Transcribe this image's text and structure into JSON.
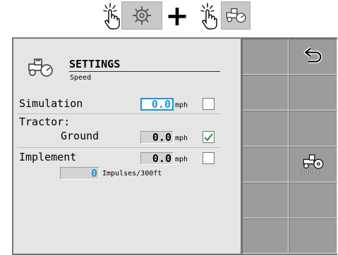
{
  "instruction": {
    "hand_icon_1": "tap-hand",
    "settings_icon": "gear",
    "plus": "+",
    "hand_icon_2": "tap-hand",
    "tractor_icon": "tractor-gauge"
  },
  "settings": {
    "title": "SETTINGS",
    "subtitle": "Speed",
    "rows": {
      "simulation": {
        "label": "Simulation",
        "value": "0.0",
        "unit": "mph",
        "checked": false
      },
      "tractor": {
        "label": "Tractor:",
        "ground_label": "Ground",
        "value": "0.0",
        "unit": "mph",
        "checked": true
      },
      "implement": {
        "label": "Implement",
        "value": "0.0",
        "unit": "mph",
        "checked": false,
        "impulses_value": "0",
        "impulses_unit": "Impulses/300ft"
      }
    }
  },
  "softkeys": {
    "back_icon": "return-arrow",
    "calibrate_label": "300ft",
    "calibrate_icon": "tractor-300ft"
  },
  "colors": {
    "accent": "#1e96d2",
    "panel": "#e5e5e5",
    "softkey": "#9c9c9c"
  }
}
